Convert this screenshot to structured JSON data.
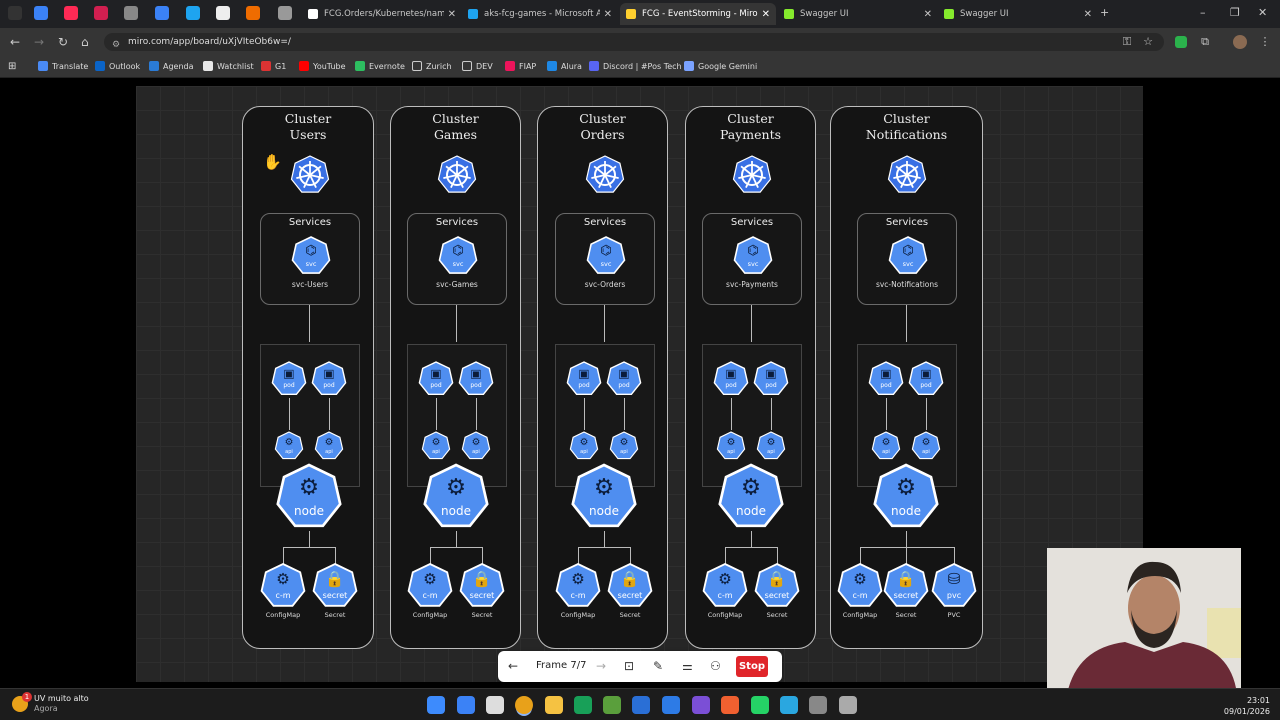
{
  "browser": {
    "tabs": [
      {
        "title": "FCG.Orders/Kubernetes/names",
        "color": "#ffffff",
        "active": false
      },
      {
        "title": "aks-fcg-games - Microsoft Azu",
        "color": "#1ea4f0",
        "active": false
      },
      {
        "title": "FCG - EventStorming - Miro",
        "color": "#ffd02f",
        "active": true
      },
      {
        "title": "Swagger UI",
        "color": "#85ea2d",
        "active": false
      },
      {
        "title": "Swagger UI",
        "color": "#85ea2d",
        "active": false
      }
    ],
    "url": "miro.com/app/board/uXjVIteOb6w=/",
    "bookmarks": [
      "Translate",
      "Outlook",
      "Agenda",
      "Watchlist",
      "G1",
      "YouTube",
      "Evernote",
      "Zurich",
      "DEV",
      "FIAP",
      "Alura",
      "Discord | #Pos Tech",
      "Google Gemini"
    ],
    "bookmark_colors": [
      "#4a8af4",
      "#0a64c8",
      "#2a7bd6",
      "#e8e8e8",
      "#d33",
      "#ff0000",
      "#2dbe60",
      "#ccc",
      "#ccc",
      "#ed145b",
      "#1e88e5",
      "#5865f2",
      "#7aa2ff"
    ]
  },
  "board": {
    "services_label": "Services",
    "clusters": [
      {
        "title": "Cluster\nUsers",
        "svc": "svc-Users",
        "extra": false
      },
      {
        "title": "Cluster\nGames",
        "svc": "svc-Games",
        "extra": false
      },
      {
        "title": "Cluster\nOrders",
        "svc": "svc-Orders",
        "extra": false
      },
      {
        "title": "Cluster\nPayments",
        "svc": "svc-Payments",
        "extra": false
      },
      {
        "title": "Cluster\nNotifications",
        "svc": "svc-Notifications",
        "extra": true
      }
    ],
    "icon_labels": {
      "svc": "svc",
      "pod": "pod",
      "api": "api",
      "node": "node",
      "cm": "c-m",
      "secret": "secret",
      "pvc": "pvc"
    },
    "captions": {
      "cm": "ConfigMap",
      "secret": "Secret",
      "pvc": "PVC"
    },
    "accent": "#4f8ef0"
  },
  "presentation": {
    "frame": "Frame 7/7",
    "stop": "Stop"
  },
  "taskbar": {
    "weather_title": "UV muito alto",
    "weather_sub": "Agora",
    "badge": "1",
    "time": "23:01",
    "date": "09/01/2026"
  }
}
